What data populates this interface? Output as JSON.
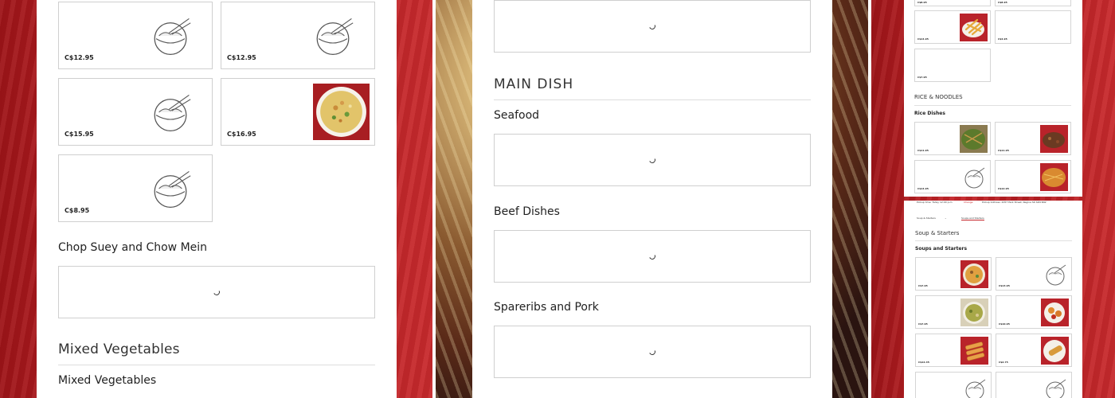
{
  "left": {
    "cards": [
      {
        "price": "C$12.95",
        "image": "placeholder-bowl-icon"
      },
      {
        "price": "C$12.95",
        "image": "placeholder-bowl-icon"
      },
      {
        "price": "C$15.95",
        "image": "placeholder-bowl-icon"
      },
      {
        "price": "C$16.95",
        "image": "fried-rice-photo"
      },
      {
        "price": "C$8.95",
        "image": "placeholder-bowl-icon"
      }
    ],
    "section_chop_suey": "Chop Suey and Chow Mein",
    "category_mixed_veg": "Mixed Vegetables",
    "section_mixed_veg": "Mixed Vegetables"
  },
  "middle": {
    "category_main_dish": "MAIN DISH",
    "section_seafood": "Seafood",
    "section_beef": "Beef Dishes",
    "section_spareribs": "Spareribs and Pork"
  },
  "right_top": {
    "top_prices": [
      "C$8.95",
      "C$8.95"
    ],
    "row2_prices": [
      "C$14.95",
      "C$4.95"
    ],
    "row3_price": "C$7.95",
    "category": "RICE & NOODLES",
    "section": "Rice Dishes",
    "rice_prices": [
      "C$11.95",
      "C$11.95",
      "C$14.95",
      "C$12.95"
    ]
  },
  "right_bottom": {
    "pickup_time": "Pickup time: Today 12:00 p.m.",
    "change_link": "Change",
    "pickup_address": "Pickup Address: 2057 Park Street, Regina SK S4N 6N2",
    "category_dropdown": "Soup & Starters",
    "tab_label": "Soups and Starters",
    "category": "Soup & Starters",
    "section": "Soups and Starters",
    "prices": [
      "C$7.95",
      "C$13.95",
      "C$7.95",
      "C$10.95",
      "C$12.45",
      "C$2.75"
    ]
  },
  "colors": {
    "accent_red": "#c5262a",
    "link_red": "#c5262a"
  }
}
